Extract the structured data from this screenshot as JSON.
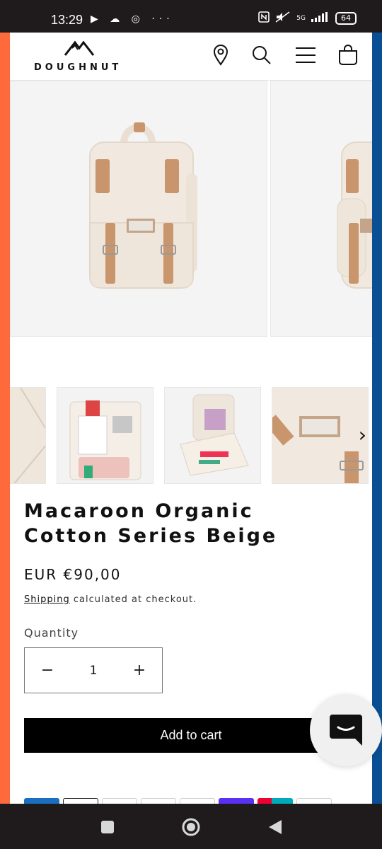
{
  "status_bar": {
    "time": "13:29",
    "left_icons": "▶ ☁ ◎ ···",
    "network": "5G",
    "battery": "64"
  },
  "header": {
    "logo_text": "DOUGHNUT",
    "icons": [
      "location-icon",
      "search-icon",
      "menu-icon",
      "cart-icon"
    ]
  },
  "gallery": {
    "thumbnails": [
      "strap-closeup",
      "inside-laptop-sleeve",
      "inside-organizer",
      "front-patch-closeup"
    ],
    "next_icon": "›"
  },
  "product": {
    "title": "Macaroon Organic Cotton Series Beige",
    "price": "EUR €90,00",
    "shipping_link": "Shipping",
    "shipping_rest": " calculated at checkout.",
    "quantity_label": "Quantity",
    "quantity_value": "1",
    "minus": "−",
    "plus": "+",
    "add_to_cart": "Add to cart"
  },
  "colors": {
    "accent_left": "#ff6a3d",
    "accent_right": "#0a4f94",
    "bag": "#f1e9df",
    "leather": "#c9956d"
  }
}
